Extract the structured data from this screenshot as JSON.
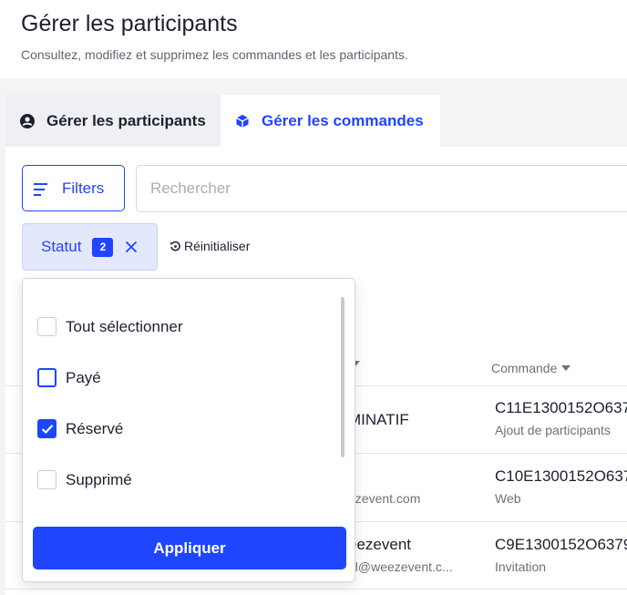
{
  "header": {
    "title": "Gérer les participants",
    "subtitle": "Consultez, modifiez et supprimez les commandes et les participants."
  },
  "tabs": [
    {
      "label": "Gérer les participants",
      "icon": "user-circle-icon",
      "active": false
    },
    {
      "label": "Gérer les commandes",
      "icon": "package-box-icon",
      "active": true
    }
  ],
  "toolbar": {
    "filters_label": "Filters",
    "search_placeholder": "Rechercher"
  },
  "active_filter": {
    "label": "Statut",
    "count": "2",
    "reset_label": "Réinitialiser"
  },
  "dropdown": {
    "options": [
      {
        "label": "Tout sélectionner",
        "checked": false
      },
      {
        "label": "Payé",
        "checked": false
      },
      {
        "label": "Réservé",
        "checked": true
      },
      {
        "label": "Supprimé",
        "checked": false
      }
    ],
    "apply_label": "Appliquer"
  },
  "table": {
    "order_column": "Commande",
    "rows": [
      {
        "name": "MINATIF",
        "email": "",
        "order": "C11E1300152O637",
        "source": "Ajout de participants"
      },
      {
        "name": "",
        "email": "ezevent.com",
        "order": "C10E1300152O637",
        "source": "Web"
      },
      {
        "name": "eezevent",
        "email": "al@weezevent.c...",
        "order": "C9E1300152O6379",
        "source": "Invitation"
      }
    ]
  },
  "colors": {
    "accent": "#1f45ff",
    "chip_bg": "#e3e8fd",
    "page_bg": "#f3f4f6"
  }
}
